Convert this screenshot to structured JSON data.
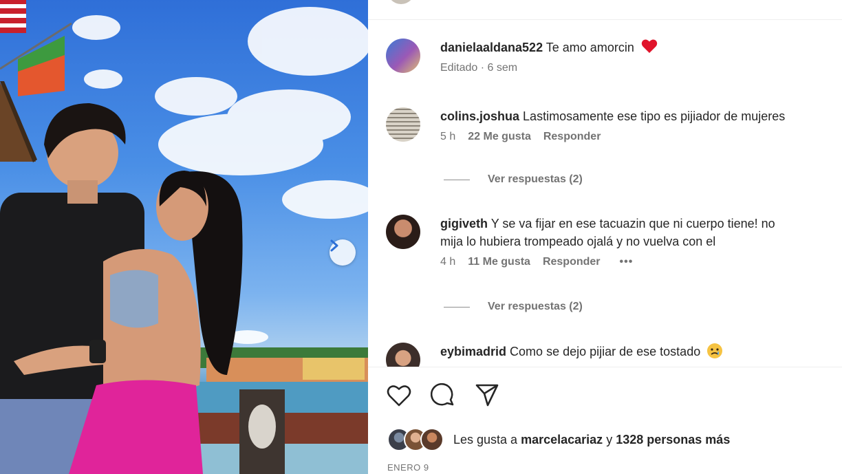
{
  "post": {
    "photo_alt": "",
    "next_icon": "chevron-right-icon"
  },
  "comments": [
    {
      "username": "danielaaldana522",
      "text": "Te amo amorcin",
      "emoji": "❤",
      "meta": {
        "edited": "Editado · 6 sem"
      },
      "avatar_color": "#3a7bd5"
    },
    {
      "username": "colins.joshua",
      "text": "Lastimosamente ese tipo es pijiador de mujeres",
      "meta": {
        "time": "5 h",
        "likes": "22 Me gusta",
        "reply": "Responder"
      },
      "view_replies": "Ver respuestas (2)",
      "avatar_color": "#b9b2a8"
    },
    {
      "username": "gigiveth",
      "text": "Y se va fijar en ese tacuazin que ni cuerpo tiene! no",
      "text_line2": "mija lo hubiera trompeado ojalá y no vuelva con el",
      "meta": {
        "time": "4 h",
        "likes": "11 Me gusta",
        "reply": "Responder",
        "more": "•••"
      },
      "view_replies": "Ver respuestas (2)",
      "avatar_color": "#4a3a32"
    },
    {
      "username": "eybimadrid",
      "text": "Como se dejo pijiar de ese tostado",
      "emoji": "😥",
      "avatar_color": "#5a4a44"
    }
  ],
  "actions": {
    "like_icon": "heart-icon",
    "comment_icon": "comment-bubble-icon",
    "share_icon": "send-paper-plane-icon"
  },
  "likes": {
    "prefix": "Les gusta a",
    "user": "marcelacariaz",
    "connector": "y",
    "others": "1328 personas más"
  },
  "date": "ENERO 9",
  "colors": {
    "text": "#262626",
    "muted": "#737373",
    "heart": "#e0142b"
  }
}
